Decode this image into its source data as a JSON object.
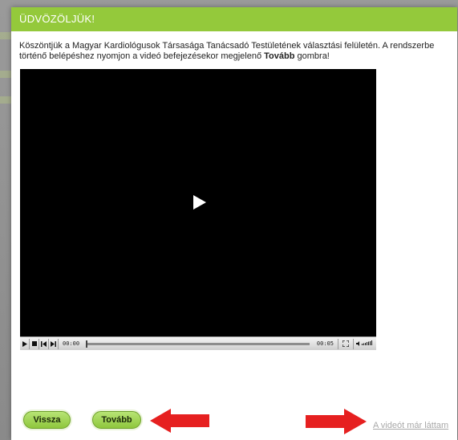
{
  "dialog": {
    "title": "ÜDVÖZÖLJÜK!",
    "intro_before": "Köszöntjük a Magyar Kardiológusok Társasága Tanácsadó Testületének választási felületén. A rendszerbe történő belépéshez nyomjon a videó befejezésekor megjelenő ",
    "intro_bold": "Tovább",
    "intro_after": " gombra!"
  },
  "video": {
    "current_time": "00:00",
    "duration": "00:05",
    "progress": 0
  },
  "buttons": {
    "back": "Vissza",
    "next": "Tovább",
    "skip": "A videót már láttam"
  },
  "colors": {
    "header_green": "#94c93b",
    "button_green": "#a6d85a",
    "annotation_red": "#e62020"
  }
}
